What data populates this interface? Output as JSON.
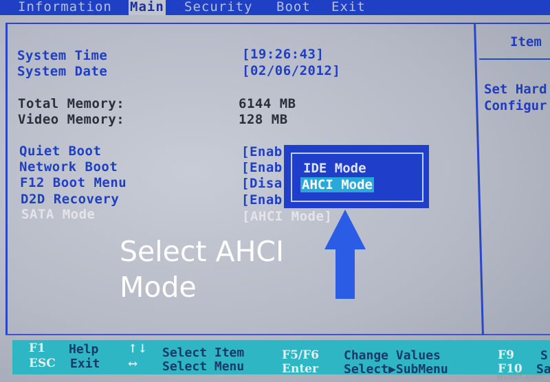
{
  "menubar": {
    "tabs": [
      {
        "label": "Information",
        "active": false
      },
      {
        "label": "Main",
        "active": true
      },
      {
        "label": "Security",
        "active": false
      },
      {
        "label": "Boot",
        "active": false
      },
      {
        "label": "Exit",
        "active": false
      }
    ]
  },
  "main": {
    "system_time": {
      "label": "System Time",
      "value": "[19:26:43]"
    },
    "system_date": {
      "label": "System Date",
      "value": "[02/06/2012]"
    },
    "total_memory": {
      "label": "Total Memory:",
      "value": "6144 MB"
    },
    "video_memory": {
      "label": "Video Memory:",
      "value": "128 MB"
    },
    "settings": [
      {
        "label": "Quiet Boot",
        "value": "[Enab"
      },
      {
        "label": "Network Boot",
        "value": "[Enab"
      },
      {
        "label": "F12 Boot Menu",
        "value": "[Disa"
      },
      {
        "label": "D2D Recovery",
        "value": "[Enab"
      },
      {
        "label": "SATA Mode",
        "value": "[AHCI Mode]"
      }
    ]
  },
  "popup": {
    "options": [
      {
        "label": "IDE Mode",
        "selected": false
      },
      {
        "label": "AHCI Mode",
        "selected": true
      }
    ]
  },
  "help_panel": {
    "title": "Item",
    "lines": [
      "Set Hard",
      "Configur"
    ]
  },
  "annotation": {
    "text": "Select AHCI\nMode",
    "arrow_icon": "up-arrow",
    "arrow_color": "#2a5ce6"
  },
  "footer": {
    "items": [
      {
        "key": "F1",
        "desc": "Help"
      },
      {
        "key": "ESC",
        "desc": "Exit"
      },
      {
        "key": "↑↓",
        "desc": "Select Item"
      },
      {
        "key": "↔",
        "desc": "Select Menu"
      },
      {
        "key": "F5/F6",
        "desc": "Change Values"
      },
      {
        "key": "Enter",
        "desc": "Select▶SubMenu"
      },
      {
        "key": "F9",
        "desc": "S"
      },
      {
        "key": "F10",
        "desc": "Sa"
      }
    ]
  },
  "watermark": "wsxdn.com"
}
